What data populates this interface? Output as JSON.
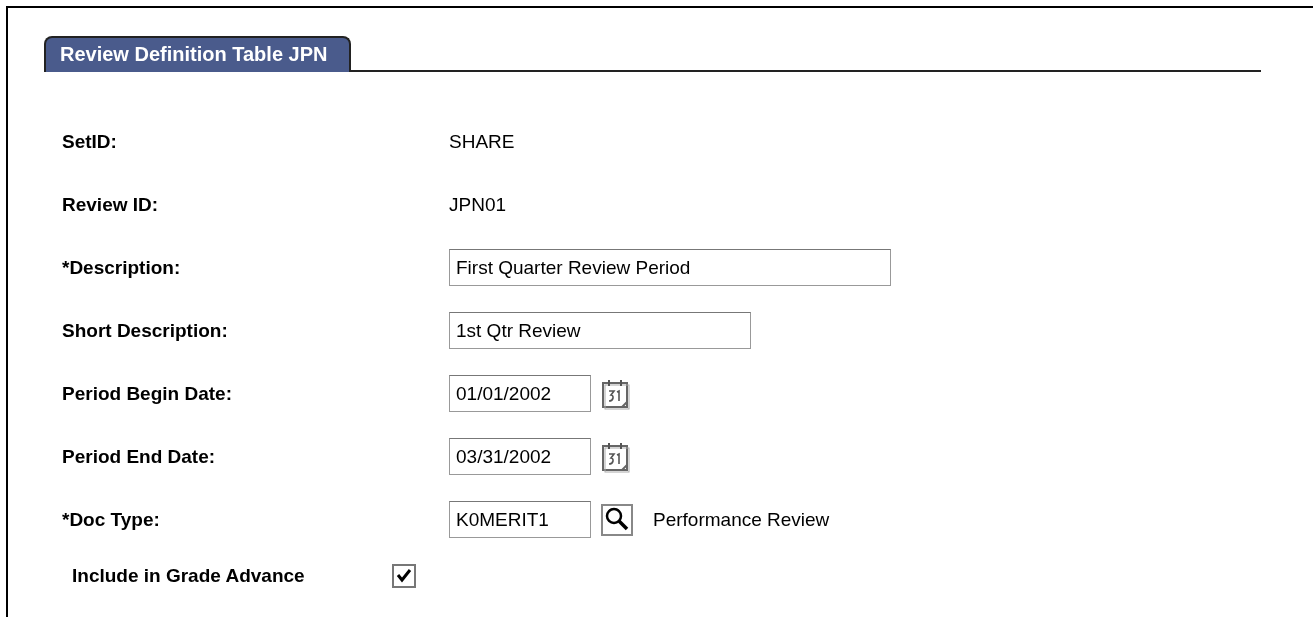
{
  "tab": {
    "label": "Review Definition Table JPN",
    "selected": true
  },
  "fields": [
    {
      "kind": "text",
      "label": "SetID:",
      "value": "SHARE"
    },
    {
      "kind": "text",
      "label": "Review ID:",
      "value": "JPN01"
    },
    {
      "kind": "long_input",
      "label": "*Description:",
      "value": "First Quarter Review Period"
    },
    {
      "kind": "short_input",
      "label": "Short Description:",
      "value": "1st Qtr Review"
    },
    {
      "kind": "date",
      "label": "Period Begin Date:",
      "value": "01/01/2002"
    },
    {
      "kind": "date",
      "label": "Period End Date:",
      "value": "03/31/2002"
    },
    {
      "kind": "lookup",
      "label": "*Doc Type:",
      "value": "K0MERIT1",
      "note": "Performance Review"
    }
  ],
  "include_in_grade_advance": {
    "label": "Include in Grade Advance",
    "checked": true
  }
}
